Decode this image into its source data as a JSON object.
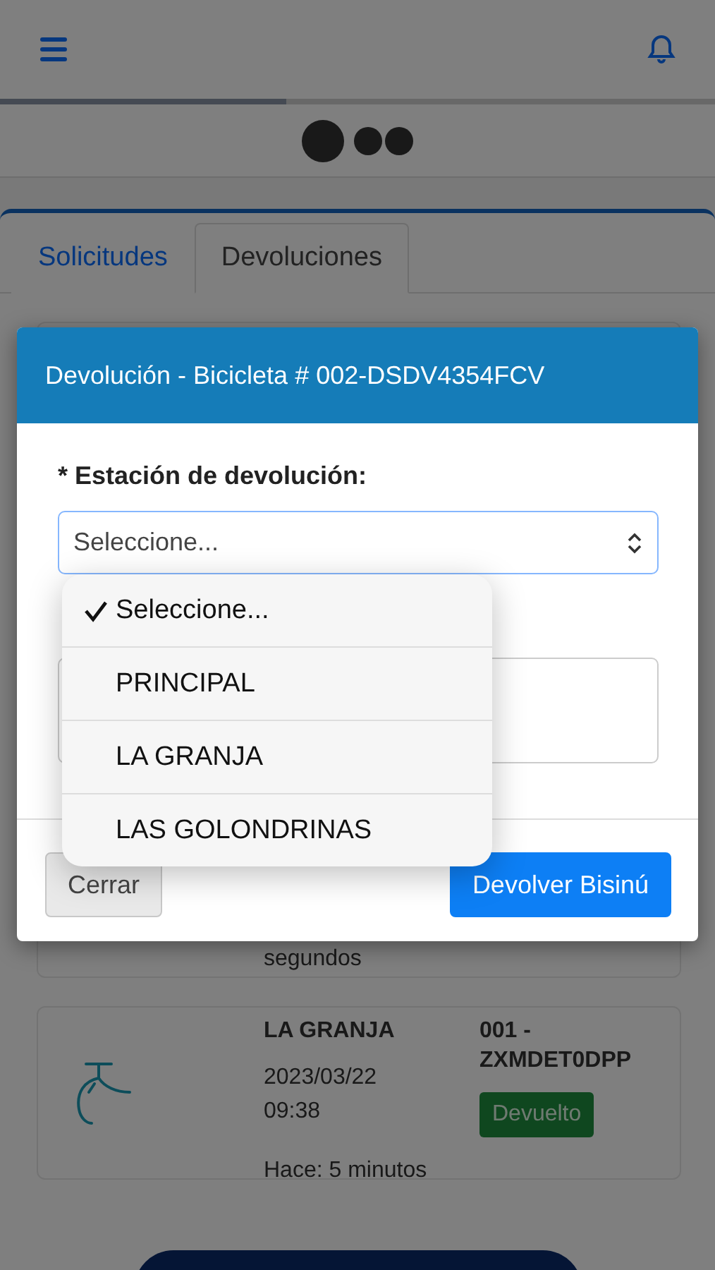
{
  "progress": {
    "level": 0.4
  },
  "tabs": [
    {
      "label": "Solicitudes",
      "selected": false
    },
    {
      "label": "Devoluciones",
      "selected": true
    }
  ],
  "returns": [
    {
      "kind": "partial",
      "ago": "segundos"
    },
    {
      "kind": "full",
      "station": "LA GRANJA",
      "date": "2023/03/22",
      "time": "09:38",
      "ago": "Hace: 5 minutos",
      "bike_id": "001 - ZXMDET0DPP",
      "status": "Devuelto"
    }
  ],
  "modal": {
    "title": "Devolución - Bicicleta # 002-DSDV4354FCV",
    "field_label": "* Estación de devolución:",
    "select_value": "Seleccione...",
    "buttons": [
      {
        "label": "Cerrar",
        "kind": "secondary"
      },
      {
        "label": "Devolver Bisinú",
        "kind": "primary"
      }
    ]
  },
  "dropdown": {
    "options": [
      {
        "label": "Seleccione...",
        "selected": true
      },
      {
        "label": "PRINCIPAL",
        "selected": false
      },
      {
        "label": "LA GRANJA",
        "selected": false
      },
      {
        "label": "LAS GOLONDRINAS",
        "selected": false
      }
    ]
  }
}
